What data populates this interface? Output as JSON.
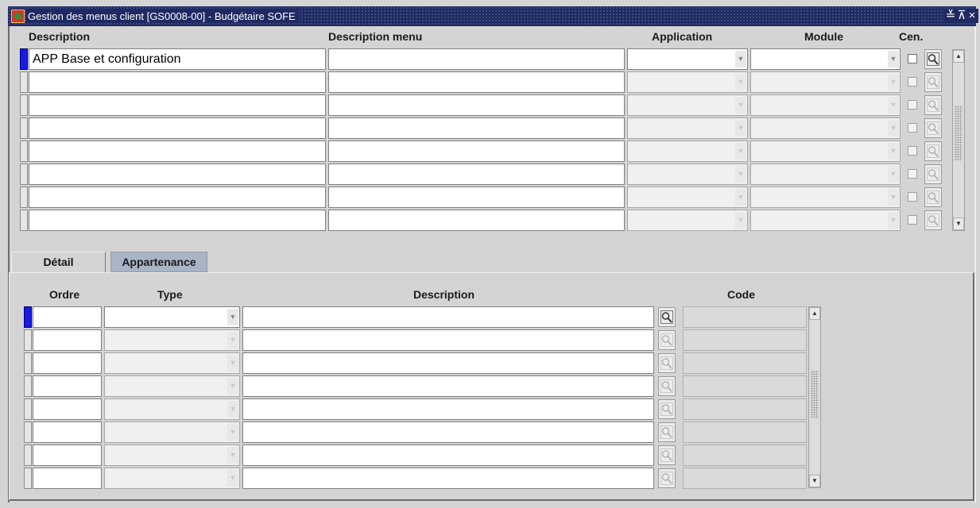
{
  "window": {
    "title": "Gestion des menus client [GS0008-00] - Budgétaire SOFE",
    "buttons": [
      "≚",
      "⊼",
      "×"
    ]
  },
  "master": {
    "headers": {
      "description": "Description",
      "description_menu": "Description menu",
      "application": "Application",
      "module": "Module",
      "cen": "Cen."
    },
    "rows": [
      {
        "description": "APP Base et configuration",
        "description_menu": "",
        "application": "",
        "module": ""
      },
      {
        "description": "",
        "description_menu": "",
        "application": "",
        "module": ""
      },
      {
        "description": "",
        "description_menu": "",
        "application": "",
        "module": ""
      },
      {
        "description": "",
        "description_menu": "",
        "application": "",
        "module": ""
      },
      {
        "description": "",
        "description_menu": "",
        "application": "",
        "module": ""
      },
      {
        "description": "",
        "description_menu": "",
        "application": "",
        "module": ""
      },
      {
        "description": "",
        "description_menu": "",
        "application": "",
        "module": ""
      },
      {
        "description": "",
        "description_menu": "",
        "application": "",
        "module": ""
      }
    ]
  },
  "tabs": [
    {
      "label": "Détail",
      "active": true
    },
    {
      "label": "Appartenance",
      "active": false
    }
  ],
  "detail": {
    "headers": {
      "ordre": "Ordre",
      "type": "Type",
      "description": "Description",
      "code": "Code"
    },
    "rows": [
      {
        "ordre": "",
        "type": "",
        "description": "",
        "code": ""
      },
      {
        "ordre": "",
        "type": "",
        "description": "",
        "code": ""
      },
      {
        "ordre": "",
        "type": "",
        "description": "",
        "code": ""
      },
      {
        "ordre": "",
        "type": "",
        "description": "",
        "code": ""
      },
      {
        "ordre": "",
        "type": "",
        "description": "",
        "code": ""
      },
      {
        "ordre": "",
        "type": "",
        "description": "",
        "code": ""
      },
      {
        "ordre": "",
        "type": "",
        "description": "",
        "code": ""
      },
      {
        "ordre": "",
        "type": "",
        "description": "",
        "code": ""
      }
    ]
  },
  "colors": {
    "titlebar": "#1f2a63",
    "record_indicator_active": "#1a1ae6",
    "inactive_tab": "#a9b4c6",
    "background": "#d4d4d4"
  }
}
